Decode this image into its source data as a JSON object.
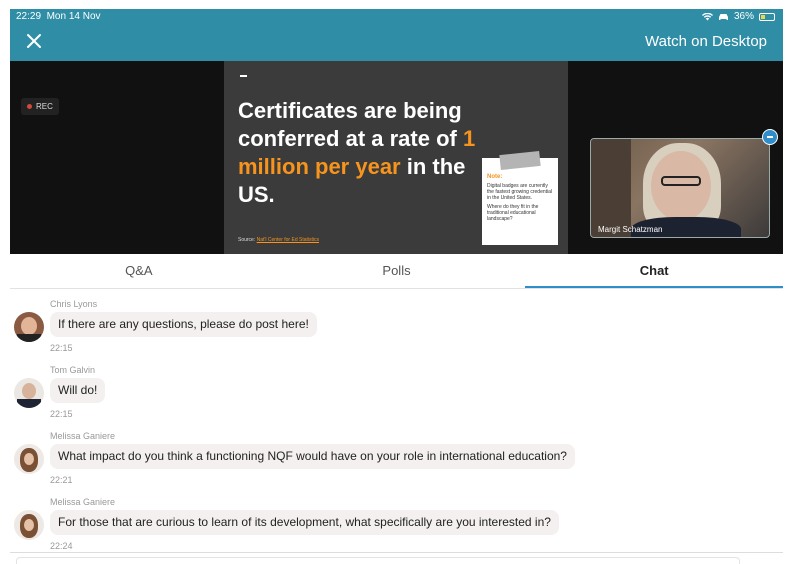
{
  "status_bar": {
    "time": "22:29",
    "date": "Mon 14 Nov",
    "battery": "36%",
    "battery_level": 0.36
  },
  "header": {
    "close_icon": "close-icon",
    "watch_label": "Watch on Desktop",
    "color": "#2f8ea6"
  },
  "video": {
    "rec_label": "REC",
    "slide": {
      "headline_pre": "Certificates are being conferred at a rate of ",
      "headline_highlight": "1 million per year",
      "headline_post": " in the US.",
      "source_prefix": "Source: ",
      "source_link": "Nat'l Center for Ed Statistics",
      "note_title": "Note:",
      "note_line1": "Digital badges are currently the fastest growing credential in the United States.",
      "note_line2": "Where do they fit in the traditional educational landscape?",
      "accent": "#f7941d"
    },
    "presenter_name": "Margit Schatzman"
  },
  "tabs": [
    {
      "label": "Q&A",
      "active": false
    },
    {
      "label": "Polls",
      "active": false
    },
    {
      "label": "Chat",
      "active": true
    }
  ],
  "messages": [
    {
      "sender": "Chris Lyons",
      "text": "If there are any questions, please do post here!",
      "time": "22:15"
    },
    {
      "sender": "Tom Galvin",
      "text": "Will do!",
      "time": "22:15"
    },
    {
      "sender": "Melissa Ganiere",
      "text": "What impact do you think a functioning NQF would have on your role in international education?",
      "time": "22:21"
    },
    {
      "sender": "Melissa Ganiere",
      "text": "For those that are curious to learn of its development, what specifically are you interested in?",
      "time": "22:24"
    }
  ]
}
